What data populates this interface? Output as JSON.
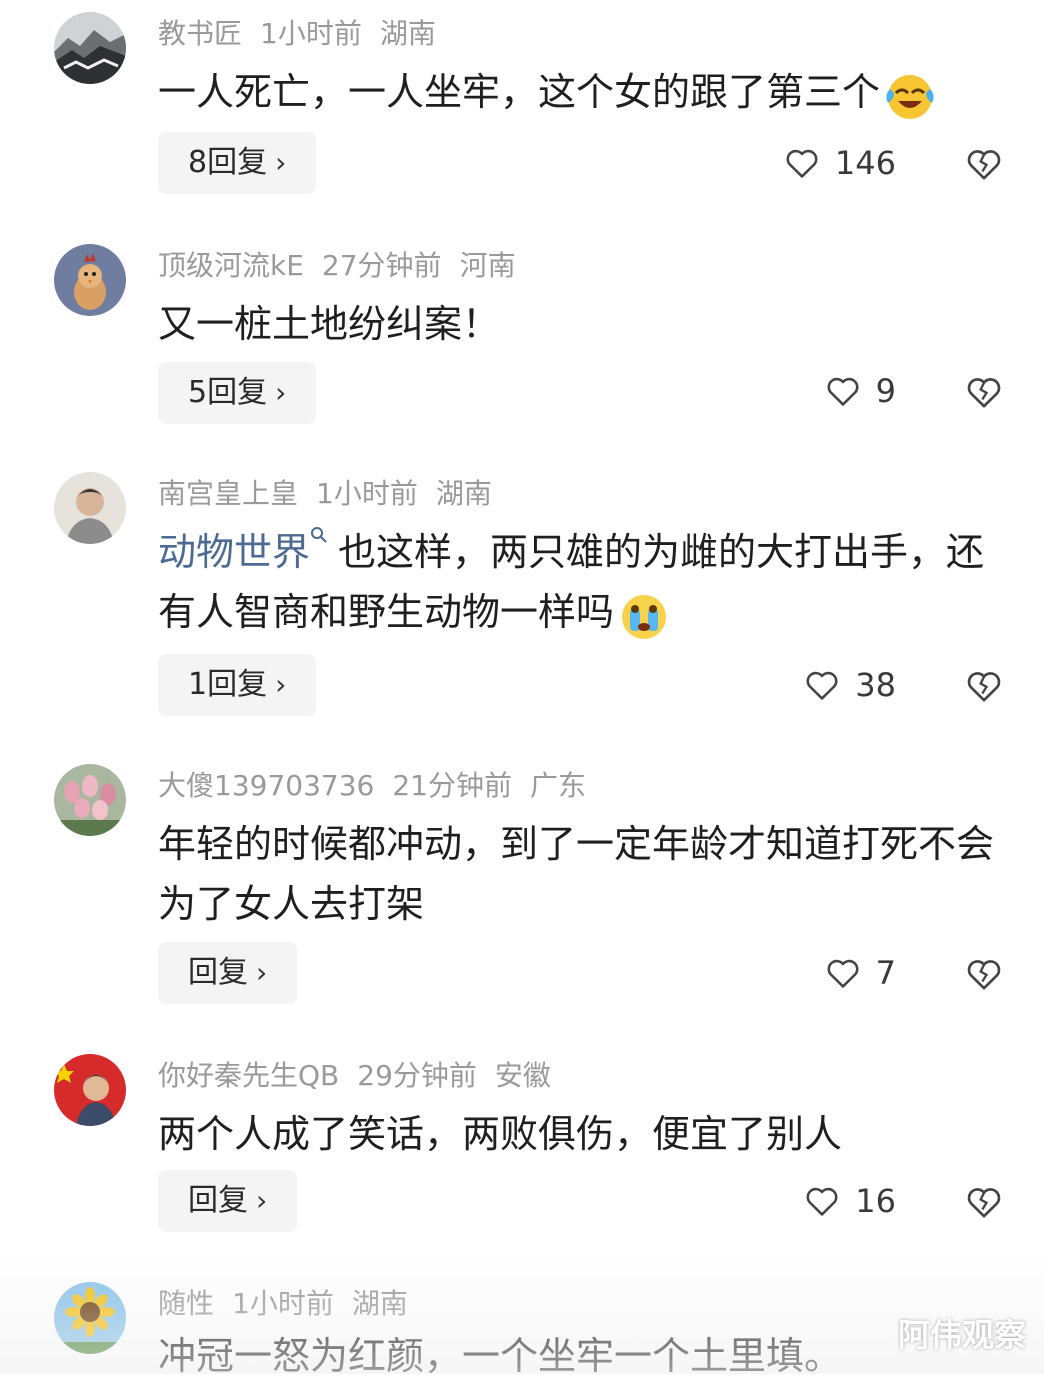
{
  "comments": [
    {
      "username": "教书匠",
      "time": "1小时前",
      "location": "湖南",
      "text_before": "一人死亡，一人坐牢，这个女的跟了第三个",
      "mention": "",
      "text_after": "",
      "emoji": "laughing-crying-emoji",
      "reply_label": "8回复",
      "likes": "146",
      "avatar": "snowy-mountain"
    },
    {
      "username": "顶级河流kE",
      "time": "27分钟前",
      "location": "河南",
      "text_before": "又一桩土地纷纠案！",
      "mention": "",
      "text_after": "",
      "emoji": "",
      "reply_label": "5回复",
      "likes": "9",
      "avatar": "rooster-cartoon"
    },
    {
      "username": "南宫皇上皇",
      "time": "1小时前",
      "location": "湖南",
      "text_before": "",
      "mention": "动物世界",
      "text_after": "也这样，两只雄的为雌的大打出手，还有人智商和野生动物一样吗",
      "emoji": "crying-emoji",
      "reply_label": "1回复",
      "likes": "38",
      "avatar": "person-photo"
    },
    {
      "username": "大傻139703736",
      "time": "21分钟前",
      "location": "广东",
      "text_before": "年轻的时候都冲动，到了一定年龄才知道打死不会为了女人去打架",
      "mention": "",
      "text_after": "",
      "emoji": "",
      "reply_label": "回复",
      "likes": "7",
      "avatar": "tulips-photo"
    },
    {
      "username": "你好秦先生QB",
      "time": "29分钟前",
      "location": "安徽",
      "text_before": "两个人成了笑话，两败俱伤，便宜了别人",
      "mention": "",
      "text_after": "",
      "emoji": "",
      "reply_label": "回复",
      "likes": "16",
      "avatar": "flag-portrait"
    },
    {
      "username": "随性",
      "time": "1小时前",
      "location": "湖南",
      "text_before": "冲冠一怒为红颜，一个坐牢一个土里填。",
      "mention": "",
      "text_after": "",
      "emoji": "",
      "reply_label": "",
      "likes": "",
      "avatar": "sunflower-photo"
    }
  ],
  "watermark": "阿伟观察",
  "colors": {
    "meta": "#9a9a9a",
    "mention": "#4c6a92",
    "reply_bg": "#f4f4f4"
  },
  "icons": {
    "like": "heart-outline-icon",
    "dislike": "broken-heart-icon",
    "chevron": "chevron-right-icon",
    "search": "search-icon"
  }
}
